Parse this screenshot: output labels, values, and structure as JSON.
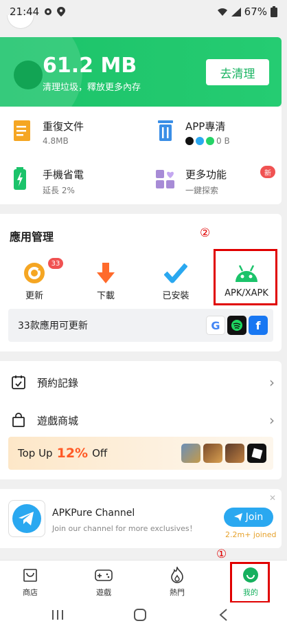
{
  "status": {
    "time": "21:44",
    "battery": "67%"
  },
  "hero": {
    "size": "61.2 MB",
    "subtitle": "清理垃圾，釋放更多內存",
    "clean_button": "去清理"
  },
  "tools": [
    {
      "title": "重復文件",
      "sub": "4.8MB",
      "icon": "document-icon"
    },
    {
      "title": "APP專清",
      "sub": "0 B",
      "icon": "trash-icon"
    },
    {
      "title": "手機省電",
      "sub": "延長 2%",
      "icon": "battery-icon"
    },
    {
      "title": "更多功能",
      "sub": "一鍵探索",
      "icon": "grid-heart-icon",
      "badge": "新"
    }
  ],
  "app_manage": {
    "title": "應用管理",
    "marker": "②",
    "items": [
      {
        "label": "更新",
        "badge": "33"
      },
      {
        "label": "下載"
      },
      {
        "label": "已安裝"
      },
      {
        "label": "APK/XAPK"
      }
    ],
    "update_text": "33款應用可更新"
  },
  "list": {
    "booking": "預約記錄",
    "store": "遊戲商城",
    "topup_prefix": "Top Up",
    "topup_pct": "12%",
    "topup_suffix": "Off"
  },
  "channel": {
    "title": "APKPure Channel",
    "sub": "Join our channel for more exclusives！",
    "join": "Join",
    "joined": "2.2m+ joined"
  },
  "nav": {
    "marker": "①",
    "items": [
      {
        "label": "商店"
      },
      {
        "label": "遊戲"
      },
      {
        "label": "熱門"
      },
      {
        "label": "我的"
      }
    ]
  },
  "colors": {
    "accent": "#1bc36a",
    "highlight": "#e00000",
    "badge": "#f05252"
  }
}
